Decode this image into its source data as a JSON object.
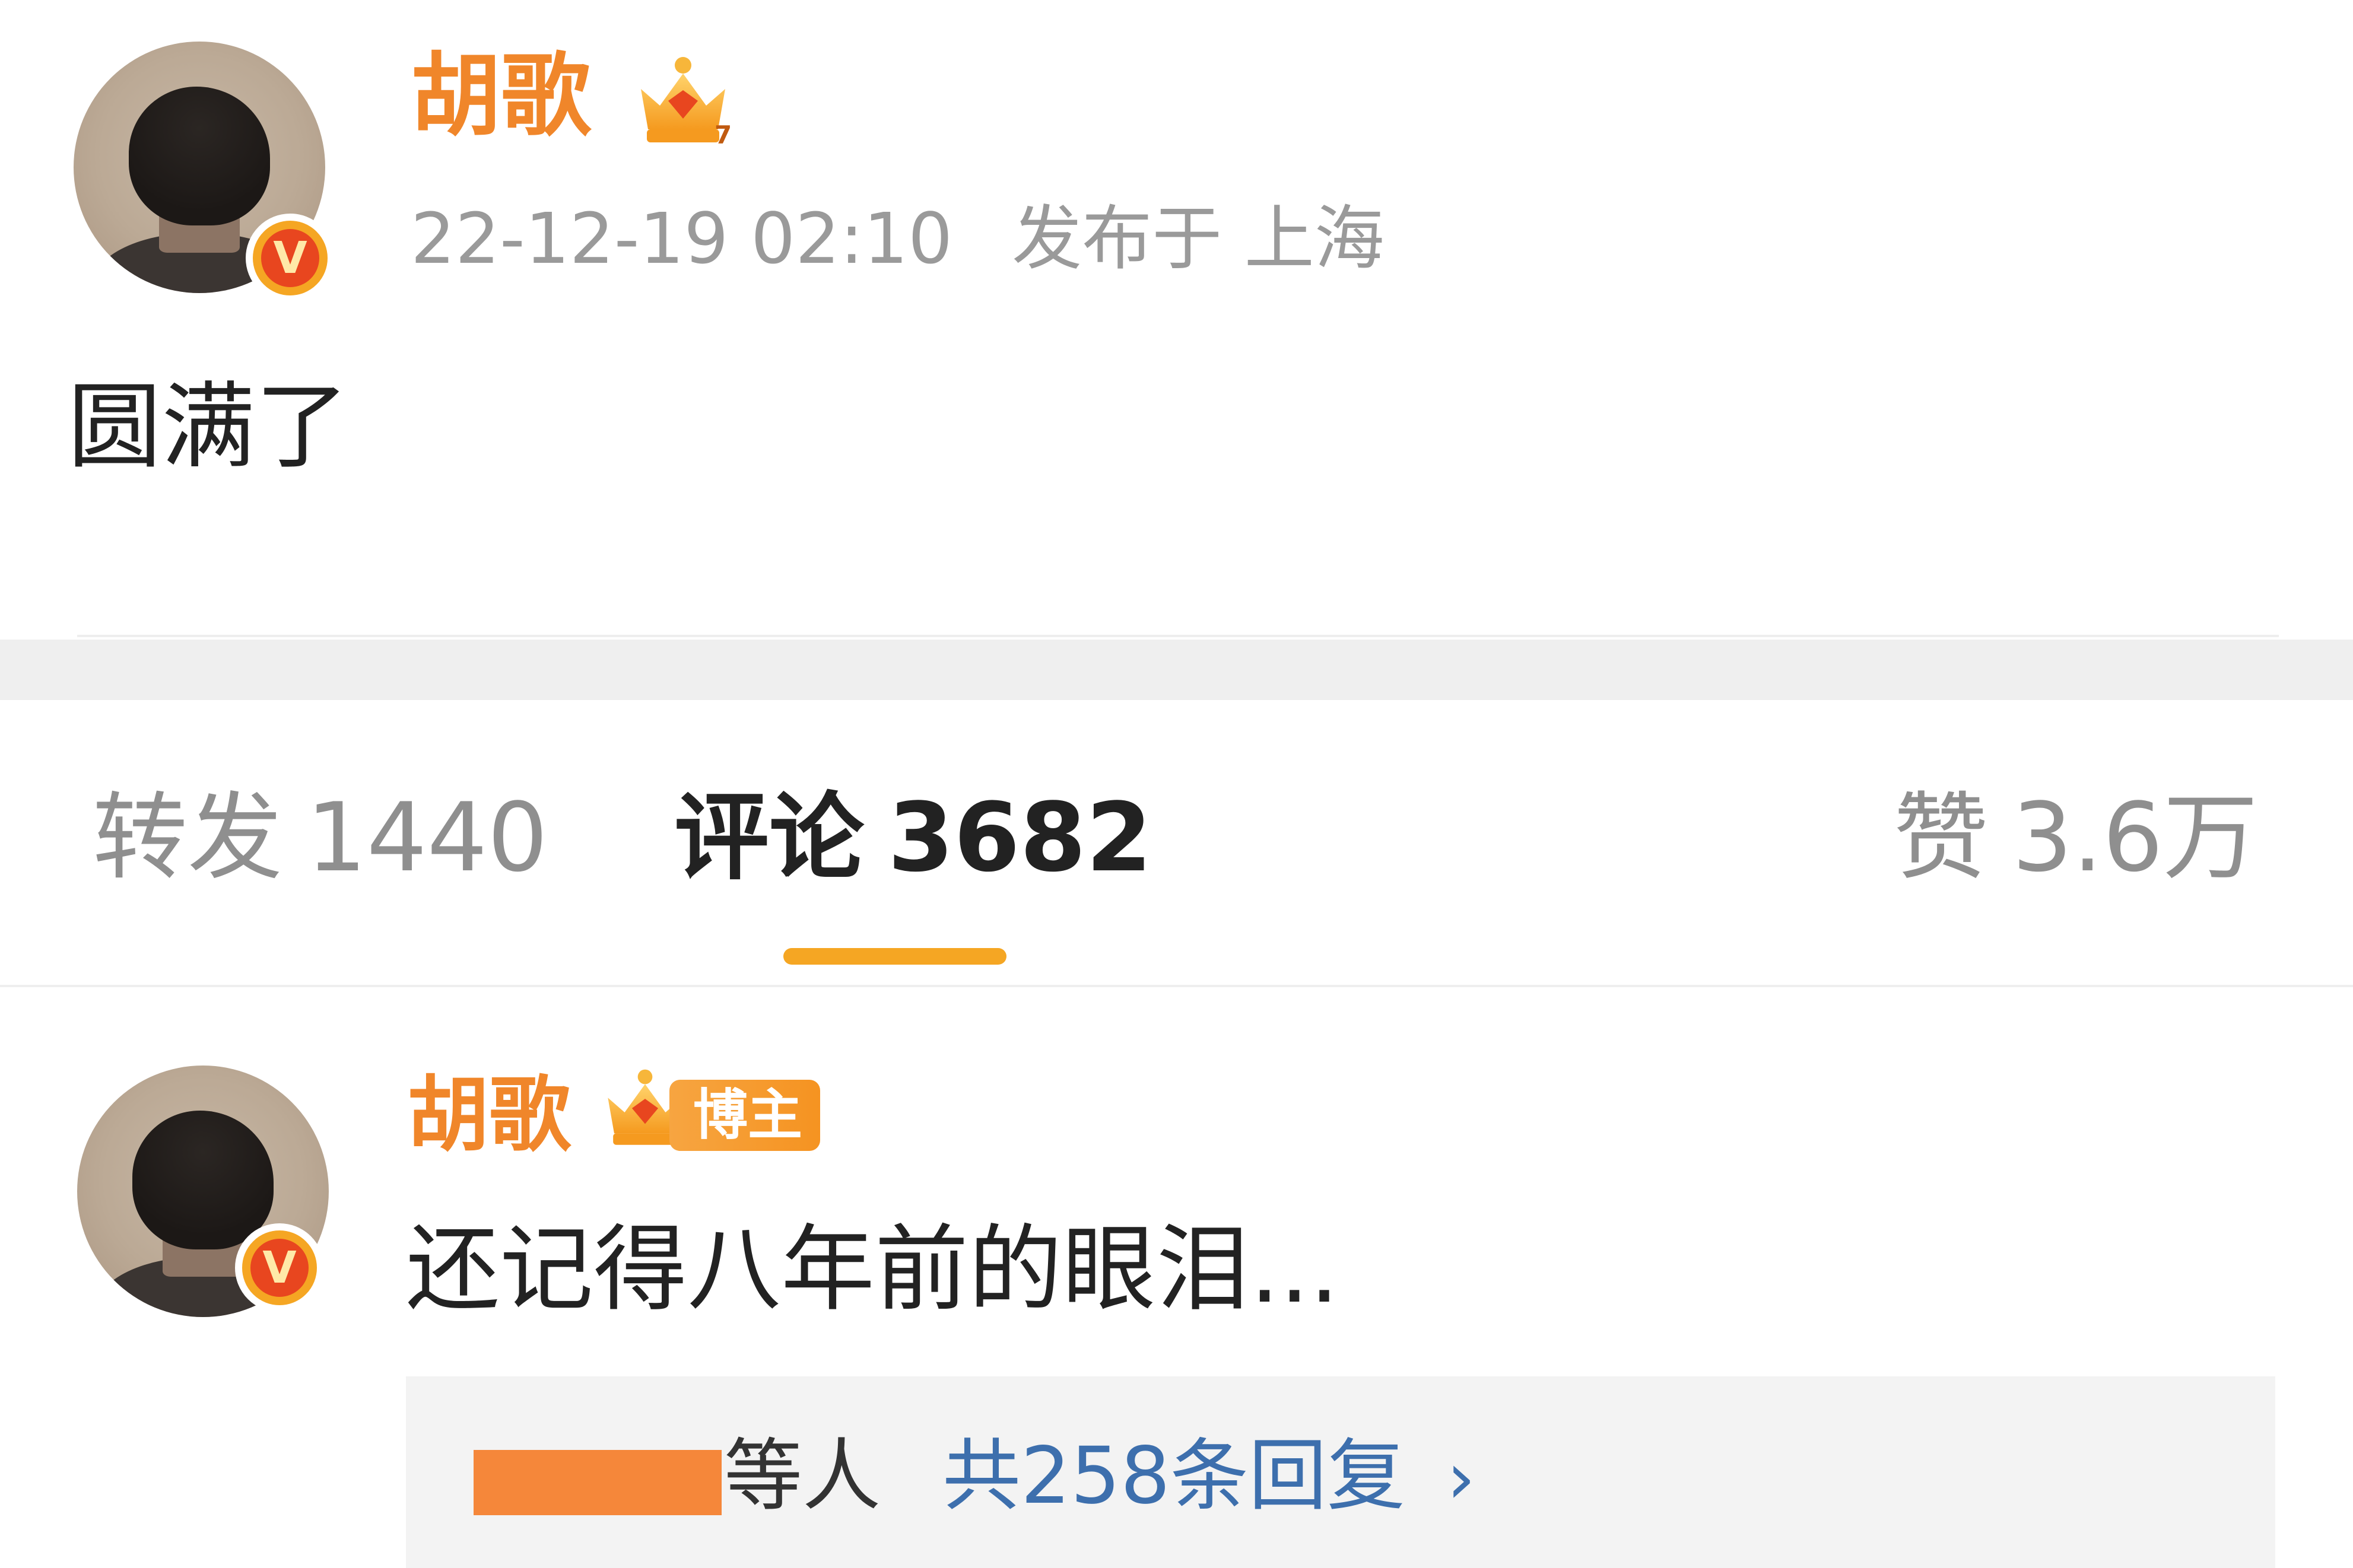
{
  "post": {
    "author": "胡歌",
    "timestamp": "22-12-19 02:10",
    "location": "发布于 上海",
    "content": "圆满了",
    "verified_icon": "v-icon",
    "level_icon": "crown-icon"
  },
  "tabs": {
    "repost_label": "转发",
    "repost_count": "1440",
    "comment_label": "评论",
    "comment_count": "3682",
    "like_label": "赞",
    "like_count": "3.6万",
    "active": "comment"
  },
  "comment": {
    "author": "胡歌",
    "badge": "博主",
    "text": "还记得八年前的眼泪...",
    "verified_icon": "v-icon",
    "level_icon": "crown-icon",
    "replies": {
      "others_suffix": "等人",
      "count_label": "共258条回复",
      "chevron": "›"
    }
  },
  "colors": {
    "name_orange": "#f0862a",
    "accent": "#f5a623",
    "link_blue": "#3d6fad",
    "meta_gray": "#9a9a9a",
    "redaction": "#f5873a"
  }
}
